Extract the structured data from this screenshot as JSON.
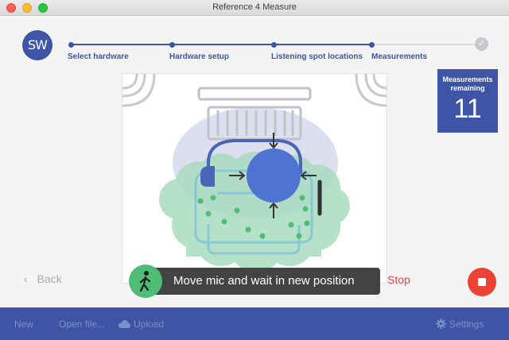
{
  "window": {
    "title": "Reference 4 Measure"
  },
  "logo": {
    "text": "SW"
  },
  "steps": [
    {
      "label": "Select hardware",
      "state": "done"
    },
    {
      "label": "Hardware setup",
      "state": "done"
    },
    {
      "label": "Listening spot locations",
      "state": "done"
    },
    {
      "label": "Measurements",
      "state": "active"
    },
    {
      "label": "",
      "state": "pending"
    }
  ],
  "measurements": {
    "label": "Measurements remaining",
    "count": "11"
  },
  "nav": {
    "back_label": "Back"
  },
  "toast": {
    "message": "Move mic and wait in new position",
    "icon": "walking-person-icon"
  },
  "stop": {
    "label": "Stop",
    "icon": "stop-icon"
  },
  "footer": {
    "new_label": "New",
    "open_label": "Open file...",
    "upload_label": "Upload",
    "upload_icon": "cloud-icon",
    "settings_label": "Settings",
    "settings_icon": "gear-icon"
  },
  "colors": {
    "accent": "#3e55a5",
    "green": "#4fbd75",
    "stop_red": "#ec4135",
    "stop_text": "#e0424a"
  }
}
